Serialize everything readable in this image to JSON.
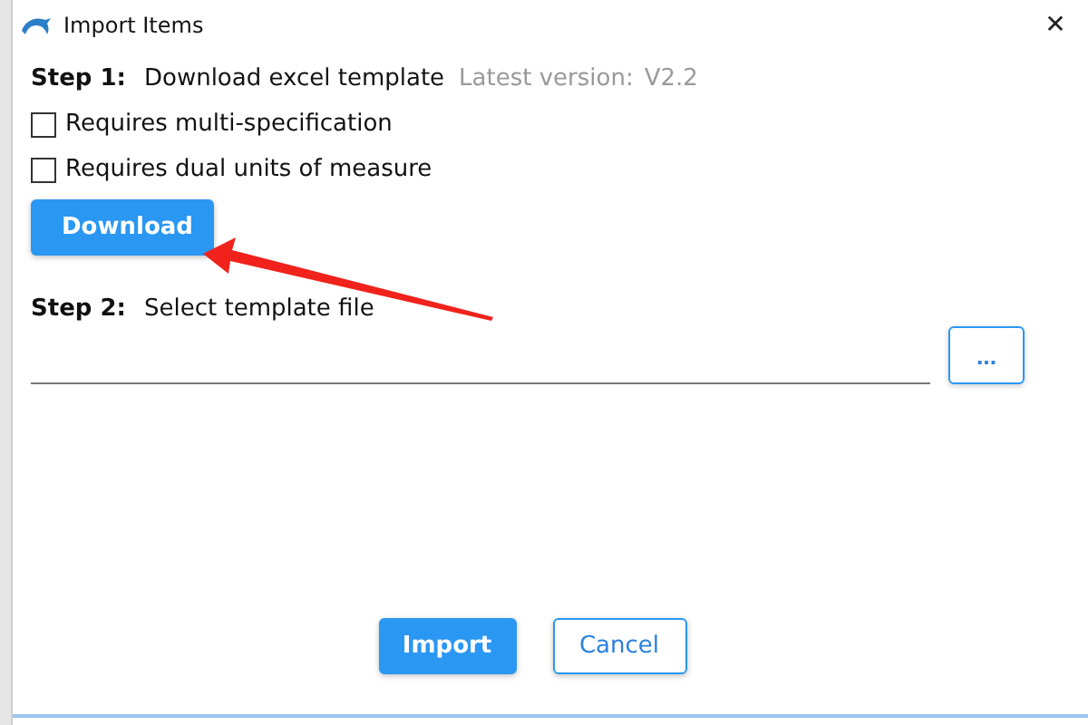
{
  "window": {
    "title": "Import Items",
    "close": "✕"
  },
  "step1": {
    "label": "Step 1:",
    "text": "Download excel template",
    "version_label": "Latest version:",
    "version": "V2.2"
  },
  "options": [
    {
      "label": "Requires multi-specification",
      "checked": false
    },
    {
      "label": "Requires dual units of measure",
      "checked": false
    }
  ],
  "download_button": "Download",
  "step2": {
    "label": "Step 2:",
    "text": "Select template file"
  },
  "browse_button": "...",
  "buttons": [
    {
      "label": "Import",
      "kind": "primary"
    },
    {
      "label": "Cancel",
      "kind": "secondary"
    }
  ]
}
